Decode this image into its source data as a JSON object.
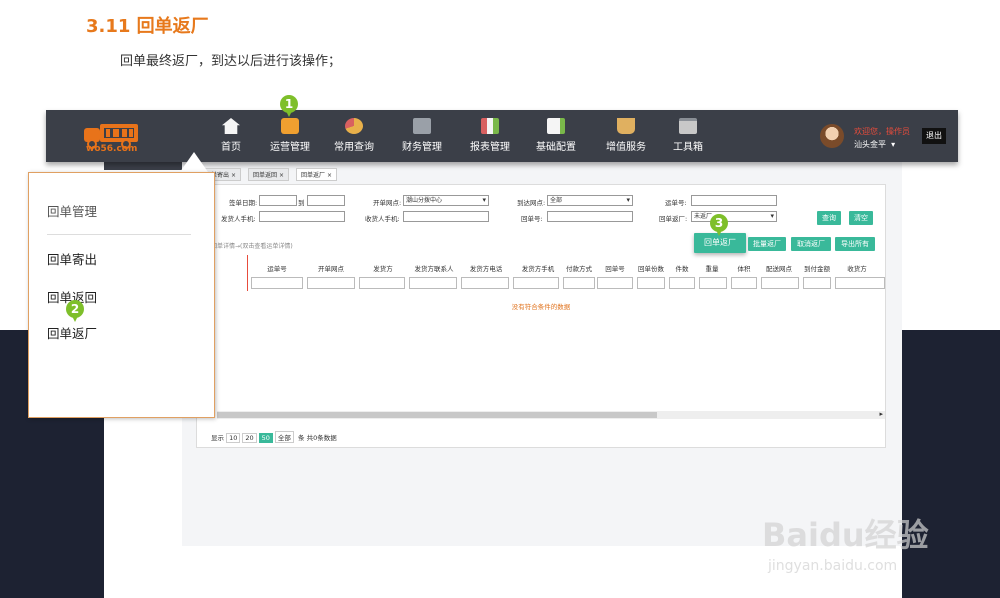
{
  "doc": {
    "heading": "3.11 回单返厂",
    "description": "回单最终返厂，到达以后进行该操作；"
  },
  "navbar": {
    "logo_text": "wo56.com",
    "items": [
      {
        "label": "首页",
        "icon": "home-icon",
        "color": "#f5f5f5"
      },
      {
        "label": "运营管理",
        "icon": "truck-icon",
        "color": "#f0a030"
      },
      {
        "label": "常用查询",
        "icon": "pie-chart-search-icon",
        "color": "#e8b04a"
      },
      {
        "label": "财务管理",
        "icon": "calculator-icon",
        "color": "#9aa0a8"
      },
      {
        "label": "报表管理",
        "icon": "report-icon",
        "color": "#d86060"
      },
      {
        "label": "基础配置",
        "icon": "edit-config-icon",
        "color": "#7ab84a"
      },
      {
        "label": "增值服务",
        "icon": "coffee-cup-icon",
        "color": "#e0b060"
      },
      {
        "label": "工具箱",
        "icon": "toolbox-icon",
        "color": "#c8c8c8"
      }
    ],
    "welcome": "欢迎您，操作员",
    "username": "汕头金平",
    "logout": "退出"
  },
  "tabs": [
    {
      "label": "回单寄出"
    },
    {
      "label": "回单返回"
    },
    {
      "label": "回单返厂"
    }
  ],
  "filters": {
    "sign_date": "签单日期:",
    "to": "到",
    "start_site": "开单网点:",
    "start_site_value": "潮山分拨中心",
    "arrive_site": "到达网点:",
    "arrive_site_value": "全部",
    "waybill_no": "运单号:",
    "sender_phone": "发货人手机:",
    "receiver_phone": "收货人手机:",
    "receipt_no": "回单号:",
    "return_status": "回单返厂:",
    "return_status_value": "未返厂",
    "query": "查询",
    "clear": "清空"
  },
  "actions": {
    "return_receipt": "回单返厂",
    "batch_return": "批量返厂",
    "cancel_return": "取消返厂",
    "export_all": "导出所有"
  },
  "hint": "回单详情→(双击查看运单详情)",
  "table": {
    "columns": [
      "运单号",
      "开单网点",
      "发货方",
      "发货方联系人",
      "发货方电话",
      "发货方手机",
      "付款方式",
      "回单号",
      "回单份数",
      "件数",
      "重量",
      "体积",
      "配送网点",
      "到付金额",
      "收货方"
    ],
    "empty_text": "没有符合条件的数据"
  },
  "pager": {
    "show": "显示",
    "sizes": [
      "10",
      "20",
      "50",
      "全部"
    ],
    "summary": "条 共0条数据"
  },
  "popup": {
    "title": "回单管理",
    "items": [
      "回单寄出",
      "回单返回",
      "回单返厂"
    ]
  },
  "markers": [
    "1",
    "2",
    "3"
  ],
  "watermark": {
    "brand": "Baidu经验",
    "url": "jingyan.baidu.com"
  },
  "colors": {
    "accent_orange": "#e7791c",
    "nav_bg": "#3b3f48",
    "button_green": "#39b99a",
    "marker_green": "#7ebf2a",
    "dark_bg": "#1d2232"
  }
}
